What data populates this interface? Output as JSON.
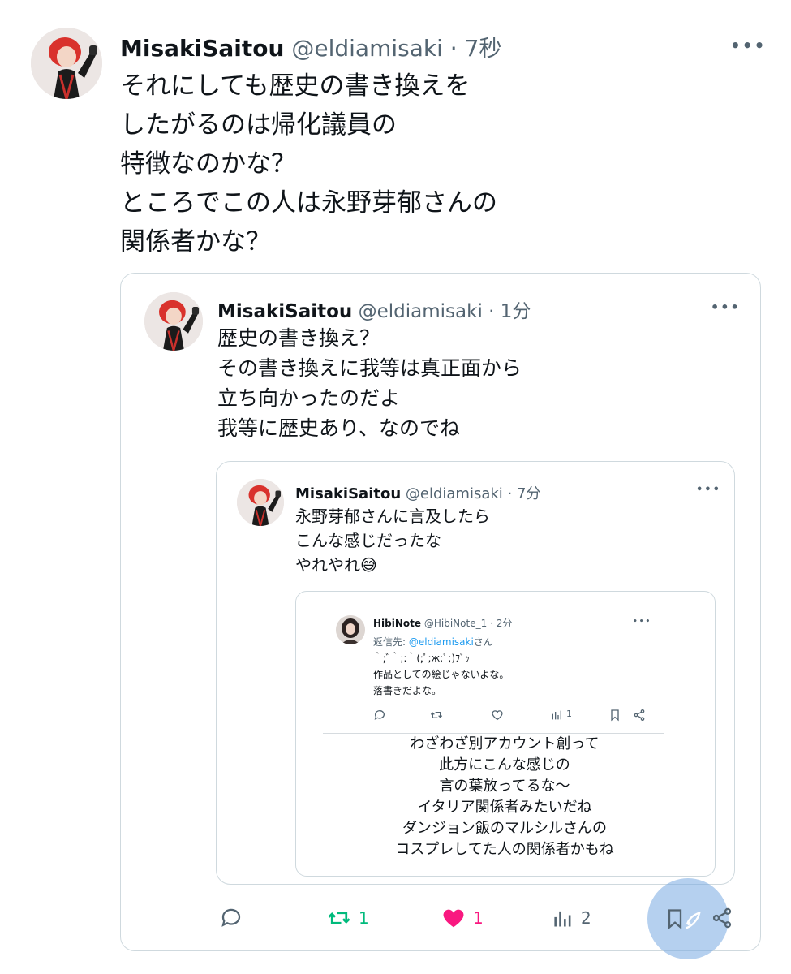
{
  "outer_tweet": {
    "display_name": "MisakiSaitou",
    "handle": "@eldiamisaki",
    "sep": "·",
    "time": "7秒",
    "more": "•••",
    "lines": [
      "それにしても歴史の書き換えを",
      "したがるのは帰化議員の",
      "特徴なのかな？",
      "ところでこの人は永野芽郁さんの",
      "関係者かな？"
    ]
  },
  "quote1": {
    "display_name": "MisakiSaitou",
    "handle": "@eldiamisaki",
    "sep": "·",
    "time": "1分",
    "more": "•••",
    "lines": [
      "歴史の書き換え？",
      "その書き換えに我等は真正面から",
      "立ち向かったのだよ",
      "我等に歴史あり、なのでね"
    ],
    "actions": {
      "retweets": "1",
      "likes": "1",
      "views": "2"
    }
  },
  "quote2": {
    "display_name": "MisakiSaitou",
    "handle": "@eldiamisaki",
    "sep": "·",
    "time": "7分",
    "more": "•••",
    "lines": [
      "永野芽郁さんに言及したら",
      "こんな感じだったな",
      "やれやれ"
    ],
    "emoji": "😅"
  },
  "screenshot_tweet": {
    "display_name": "HibiNote",
    "handle": "@HibiNote_1",
    "sep": "·",
    "time": "2分",
    "more": "•••",
    "reply_prefix": "返信先: ",
    "reply_handle": "@eldiamisaki",
    "reply_suffix": "さん",
    "lines": [
      "｀;ﾞ｀;:｀(;ﾟ;ж;ﾟ;)ﾌﾞｯ",
      "作品としての絵じゃないよな。",
      "落書きだよな。"
    ],
    "views": "1"
  },
  "caption_lines": [
    "わざわざ別アカウント創って",
    "此方にこんな感じの",
    "言の葉放ってるな～",
    "イタリア関係者みたいだね",
    "ダンジョン飯のマルシルさんの",
    "コスプレしてた人の関係者かもね"
  ],
  "colors": {
    "retweet_green": "#00ba7c",
    "like_pink": "#f91880",
    "muted": "#536471",
    "border": "#cfd9de"
  }
}
